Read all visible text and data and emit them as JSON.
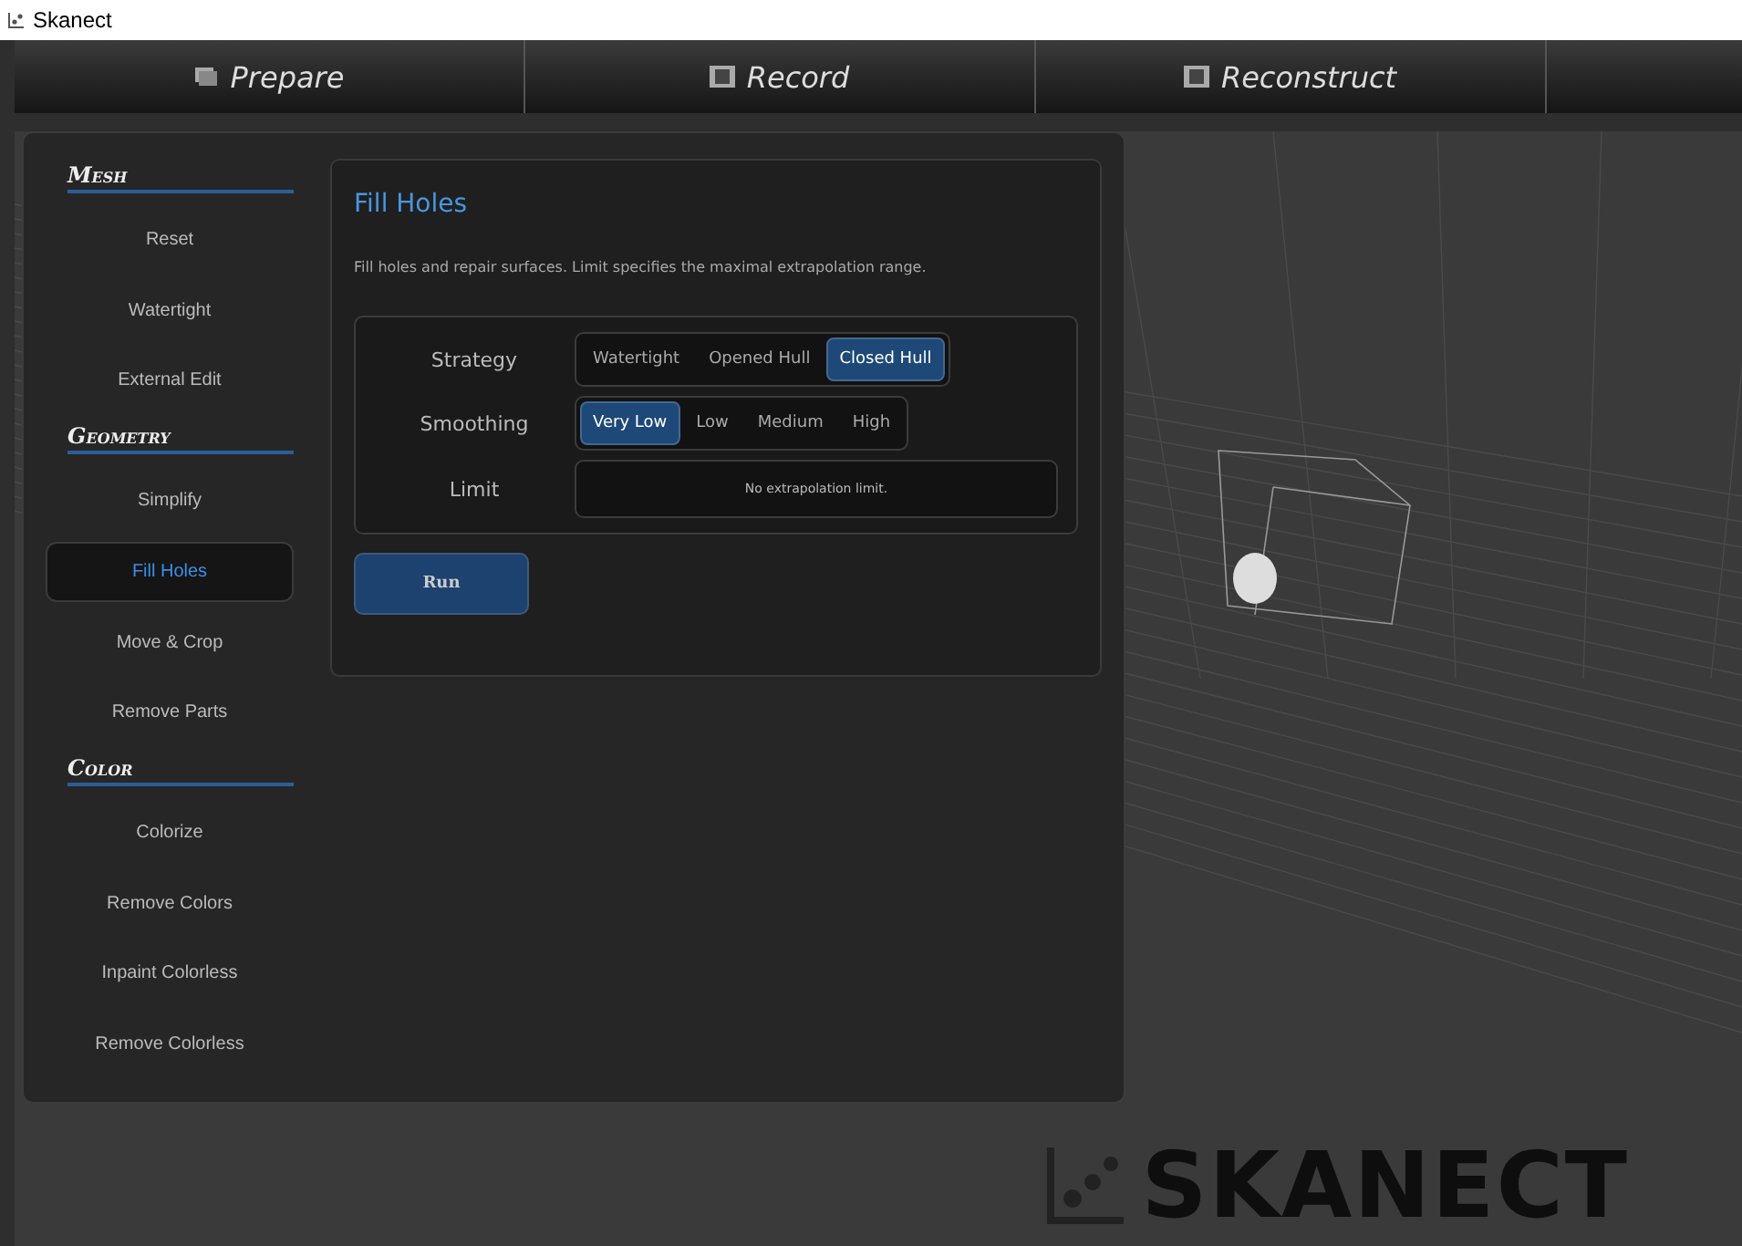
{
  "window": {
    "title": "Skanect"
  },
  "steps": [
    {
      "label": "Prepare",
      "selected": false
    },
    {
      "label": "Record",
      "selected": false
    },
    {
      "label": "Reconstruct",
      "selected": false
    }
  ],
  "sidebar": {
    "sections": [
      {
        "title": "Mesh",
        "items": [
          {
            "label": "Reset",
            "selected": false
          },
          {
            "label": "Watertight",
            "selected": false
          },
          {
            "label": "External Edit",
            "selected": false
          }
        ]
      },
      {
        "title": "Geometry",
        "items": [
          {
            "label": "Simplify",
            "selected": false
          },
          {
            "label": "Fill Holes",
            "selected": true
          },
          {
            "label": "Move & Crop",
            "selected": false
          },
          {
            "label": "Remove Parts",
            "selected": false
          }
        ]
      },
      {
        "title": "Color",
        "items": [
          {
            "label": "Colorize",
            "selected": false
          },
          {
            "label": "Remove Colors",
            "selected": false
          },
          {
            "label": "Inpaint Colorless",
            "selected": false
          },
          {
            "label": "Remove Colorless",
            "selected": false
          }
        ]
      }
    ]
  },
  "tool": {
    "title": "Fill Holes",
    "description": "Fill holes and repair surfaces. Limit specifies the maximal extrapolation range.",
    "settings": [
      {
        "kind": "segmented",
        "label": "Strategy",
        "options": [
          {
            "label": "Watertight",
            "selected": false
          },
          {
            "label": "Opened Hull",
            "selected": false
          },
          {
            "label": "Closed Hull",
            "selected": true
          }
        ]
      },
      {
        "kind": "segmented",
        "label": "Smoothing",
        "options": [
          {
            "label": "Very Low",
            "selected": true
          },
          {
            "label": "Low",
            "selected": false
          },
          {
            "label": "Medium",
            "selected": false
          },
          {
            "label": "High",
            "selected": false
          }
        ]
      },
      {
        "kind": "field",
        "label": "Limit",
        "value": "No extrapolation limit."
      }
    ],
    "run_button": "Run"
  },
  "brand": "SKANECT"
}
